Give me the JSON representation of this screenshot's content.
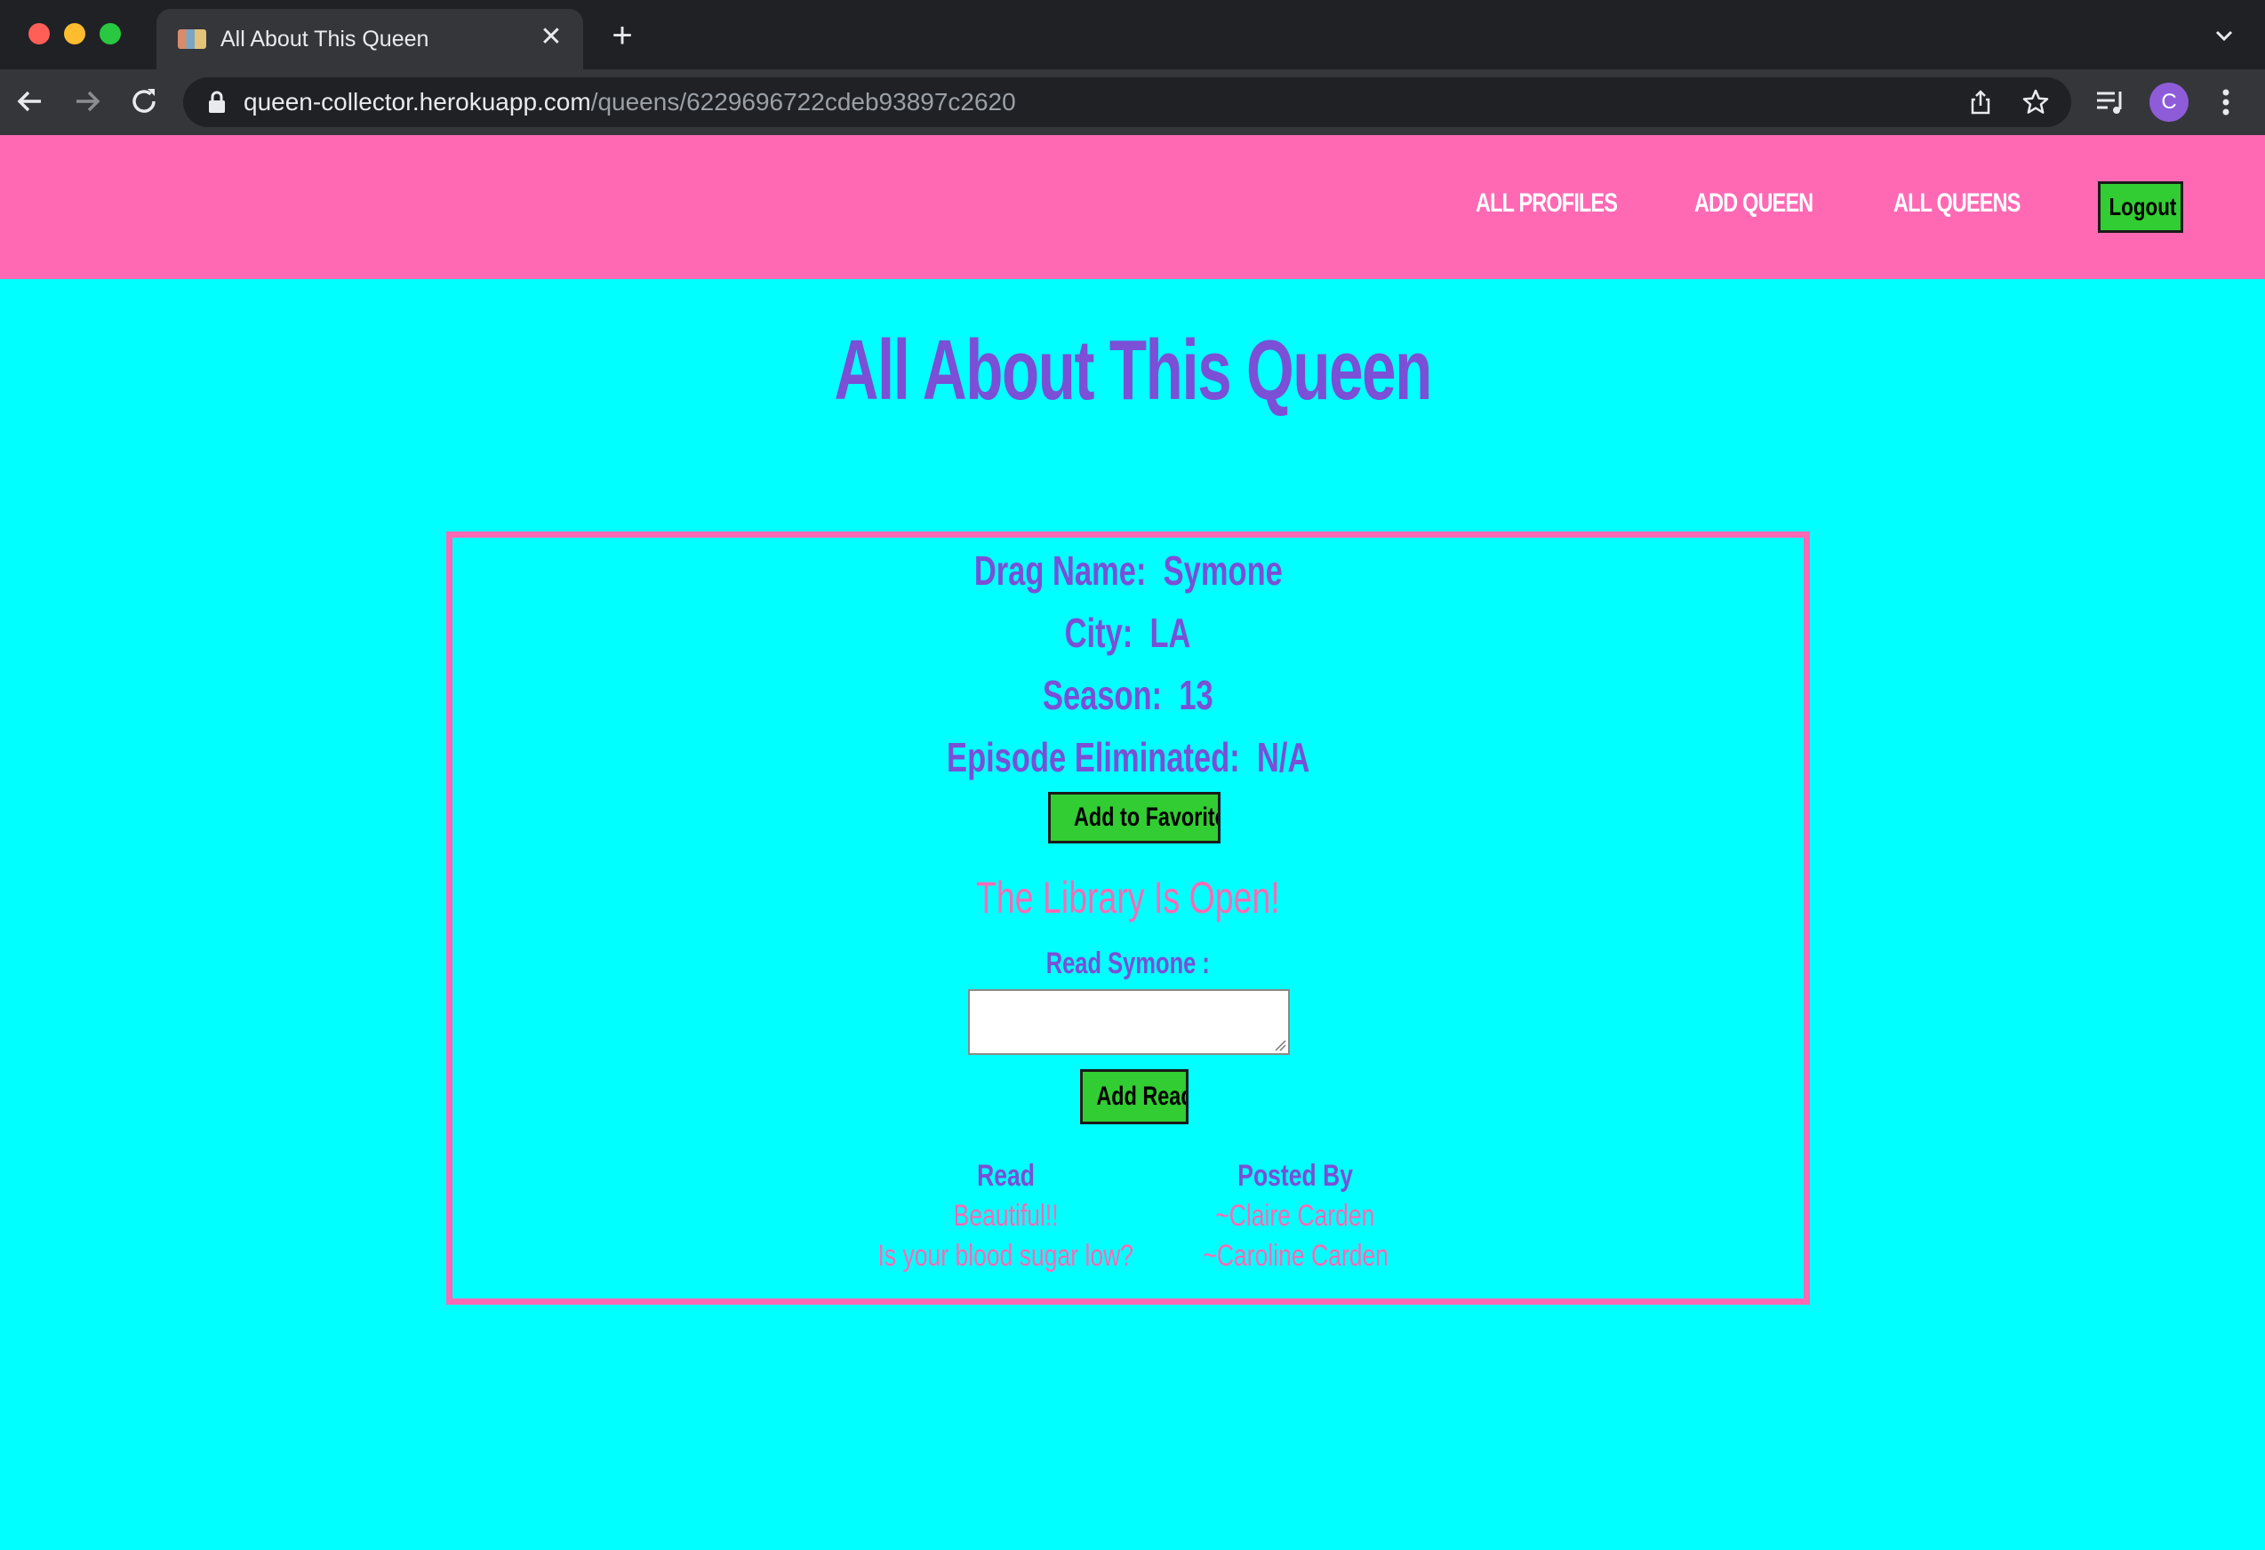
{
  "browser": {
    "tab_title": "All About This Queen",
    "url_domain": "queen-collector.herokuapp.com",
    "url_path": "/queens/6229696722cdeb93897c2620",
    "profile_initial": "C"
  },
  "nav": {
    "all_profiles": "ALL PROFILES",
    "add_queen": "ADD QUEEN",
    "all_queens": "ALL QUEENS",
    "logout": "Logout"
  },
  "page": {
    "title": "All About This Queen"
  },
  "queen": {
    "drag_name_label": "Drag Name:",
    "drag_name": "Symone",
    "city_label": "City:",
    "city": "LA",
    "season_label": "Season:",
    "season": "13",
    "episode_label": "Episode Eliminated:",
    "episode": "N/A",
    "favorite_button": "Add to Favorites"
  },
  "library": {
    "heading": "The Library Is Open!",
    "read_label": "Read Symone :",
    "input_value": "",
    "add_button": "Add Read",
    "table": {
      "headers": [
        "Read",
        "Posted By"
      ],
      "rows": [
        [
          "Beautiful!!",
          "~Claire Carden"
        ],
        [
          "Is your blood sugar low?",
          "~Caroline Carden"
        ]
      ]
    }
  },
  "colors": {
    "page_bg": "#00ffff",
    "nav_bg": "#ff69b4",
    "accent_purple": "#7b4fd6",
    "button_green": "#32cd32"
  }
}
